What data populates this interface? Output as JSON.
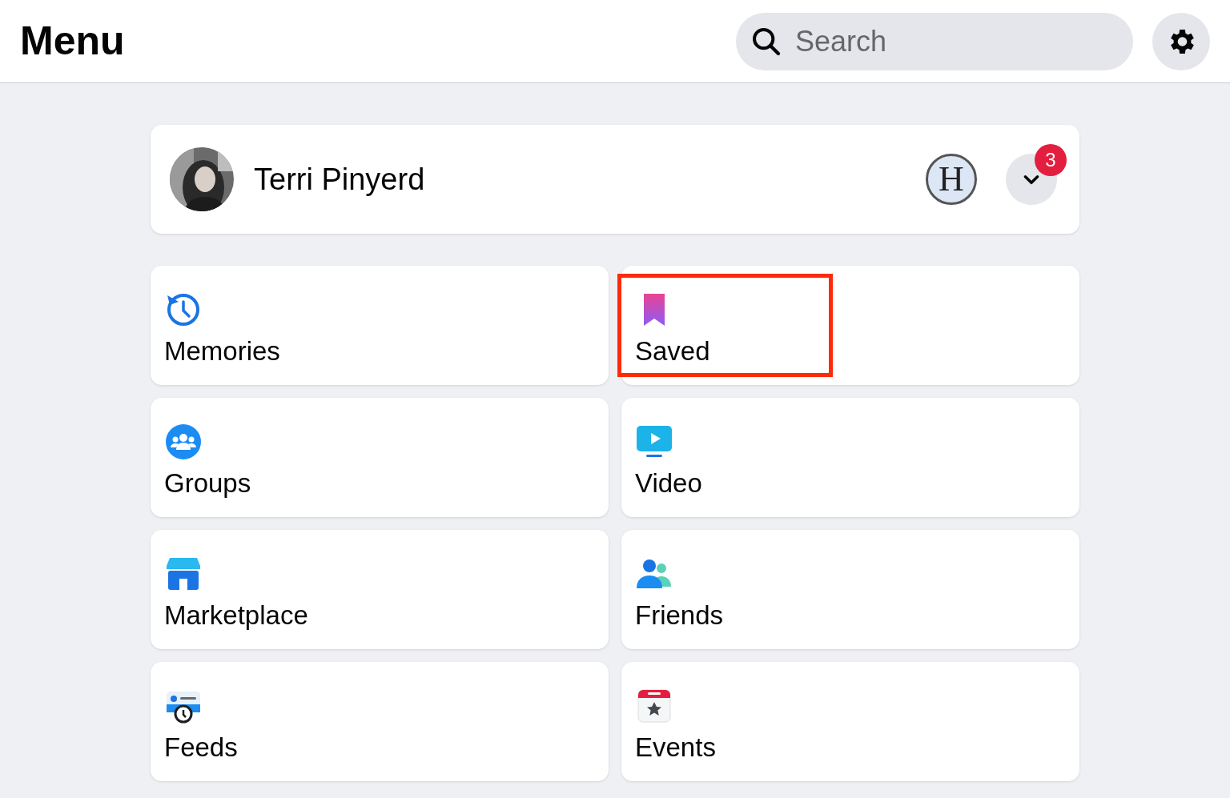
{
  "header": {
    "title": "Menu",
    "search": {
      "placeholder": "Search"
    }
  },
  "profile": {
    "name": "Terri Pinyerd",
    "logo_letter": "H",
    "notifications": "3"
  },
  "shortcuts": [
    {
      "kind": "memories",
      "label": "Memories",
      "highlighted": false
    },
    {
      "kind": "saved",
      "label": "Saved",
      "highlighted": true
    },
    {
      "kind": "groups",
      "label": "Groups",
      "highlighted": false
    },
    {
      "kind": "video",
      "label": "Video",
      "highlighted": false
    },
    {
      "kind": "marketplace",
      "label": "Marketplace",
      "highlighted": false
    },
    {
      "kind": "friends",
      "label": "Friends",
      "highlighted": false
    },
    {
      "kind": "feeds",
      "label": "Feeds",
      "highlighted": false
    },
    {
      "kind": "events",
      "label": "Events",
      "highlighted": false
    }
  ]
}
